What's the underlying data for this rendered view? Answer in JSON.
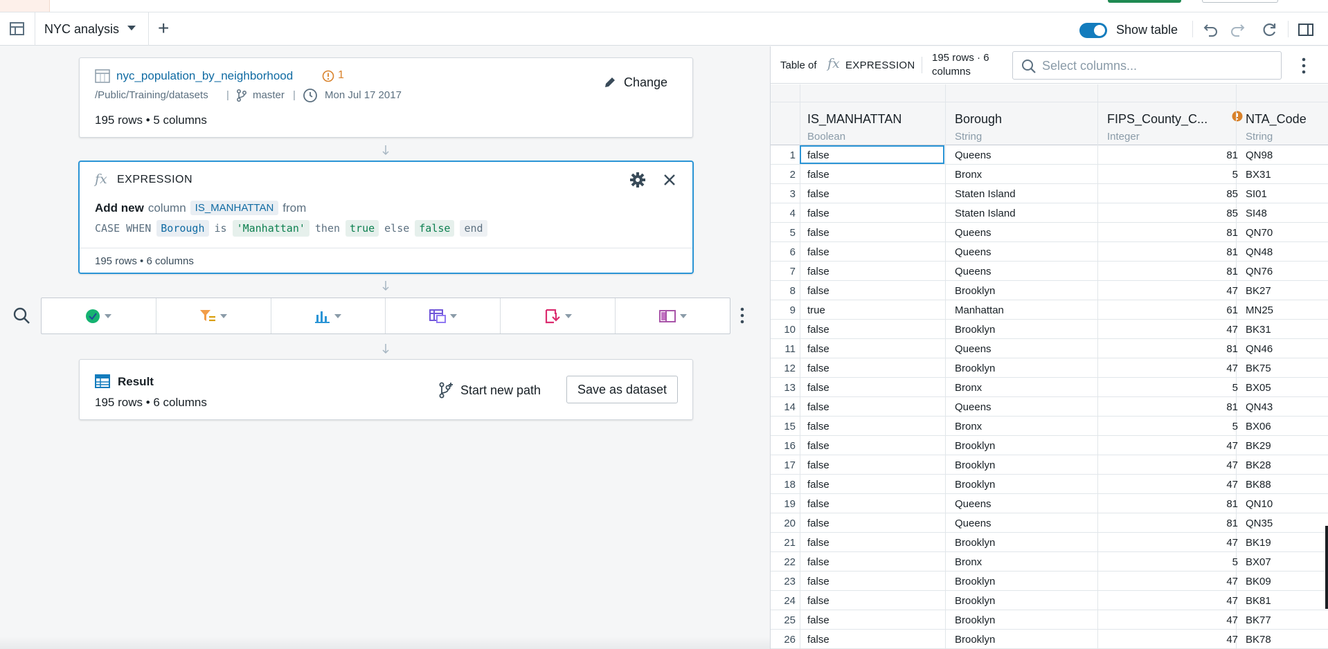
{
  "toolbar": {
    "tab_title": "NYC analysis",
    "show_table_label": "Show table",
    "show_table_on": true
  },
  "source": {
    "dataset_name": "nyc_population_by_neighborhood",
    "warning_count": "1",
    "path": "/Public/Training/datasets",
    "branch": "master",
    "date": "Mon Jul 17 2017",
    "counts": "195 rows • 5 columns",
    "change_label": "Change"
  },
  "expression": {
    "title": "EXPRESSION",
    "add_new": "Add new",
    "column_word": "column",
    "column_name": "IS_MANHATTAN",
    "from_word": "from",
    "code": {
      "case_when": "CASE WHEN",
      "field": "Borough",
      "is": "is",
      "value": "'Manhattan'",
      "then": "then",
      "true": "true",
      "else": "else",
      "false": "false",
      "end": "end"
    },
    "counts": "195 rows • 6 columns"
  },
  "action_icons": [
    "check-circle-icon",
    "filter-icon",
    "bar-chart-icon",
    "pivot-table-icon",
    "transform-icon",
    "column-layout-icon"
  ],
  "result": {
    "title": "Result",
    "counts": "195 rows • 6 columns",
    "start_path_label": "Start new path",
    "save_dataset_label": "Save as dataset"
  },
  "table_panel": {
    "table_of": "Table of",
    "expression_label": "EXPRESSION",
    "counts": "195 rows · 6 columns",
    "search_placeholder": "Select columns..."
  },
  "columns": [
    {
      "name": "IS_MANHATTAN",
      "type": "Boolean"
    },
    {
      "name": "Borough",
      "type": "String"
    },
    {
      "name": "FIPS_County_C...",
      "type": "Integer"
    },
    {
      "name": "NTA_Code",
      "type": "String"
    }
  ],
  "colors": {
    "accent": "#137cbd",
    "warning": "#d9822b",
    "link": "#106ba3"
  },
  "rows": [
    [
      "1",
      "false",
      "Queens",
      "81",
      "QN98"
    ],
    [
      "2",
      "false",
      "Bronx",
      "5",
      "BX31"
    ],
    [
      "3",
      "false",
      "Staten Island",
      "85",
      "SI01"
    ],
    [
      "4",
      "false",
      "Staten Island",
      "85",
      "SI48"
    ],
    [
      "5",
      "false",
      "Queens",
      "81",
      "QN70"
    ],
    [
      "6",
      "false",
      "Queens",
      "81",
      "QN48"
    ],
    [
      "7",
      "false",
      "Queens",
      "81",
      "QN76"
    ],
    [
      "8",
      "false",
      "Brooklyn",
      "47",
      "BK27"
    ],
    [
      "9",
      "true",
      "Manhattan",
      "61",
      "MN25"
    ],
    [
      "10",
      "false",
      "Brooklyn",
      "47",
      "BK31"
    ],
    [
      "11",
      "false",
      "Queens",
      "81",
      "QN46"
    ],
    [
      "12",
      "false",
      "Brooklyn",
      "47",
      "BK75"
    ],
    [
      "13",
      "false",
      "Bronx",
      "5",
      "BX05"
    ],
    [
      "14",
      "false",
      "Queens",
      "81",
      "QN43"
    ],
    [
      "15",
      "false",
      "Bronx",
      "5",
      "BX06"
    ],
    [
      "16",
      "false",
      "Brooklyn",
      "47",
      "BK29"
    ],
    [
      "17",
      "false",
      "Brooklyn",
      "47",
      "BK28"
    ],
    [
      "18",
      "false",
      "Brooklyn",
      "47",
      "BK88"
    ],
    [
      "19",
      "false",
      "Queens",
      "81",
      "QN10"
    ],
    [
      "20",
      "false",
      "Queens",
      "81",
      "QN35"
    ],
    [
      "21",
      "false",
      "Brooklyn",
      "47",
      "BK19"
    ],
    [
      "22",
      "false",
      "Bronx",
      "5",
      "BX07"
    ],
    [
      "23",
      "false",
      "Brooklyn",
      "47",
      "BK09"
    ],
    [
      "24",
      "false",
      "Brooklyn",
      "47",
      "BK81"
    ],
    [
      "25",
      "false",
      "Brooklyn",
      "47",
      "BK77"
    ],
    [
      "26",
      "false",
      "Brooklyn",
      "47",
      "BK78"
    ]
  ]
}
